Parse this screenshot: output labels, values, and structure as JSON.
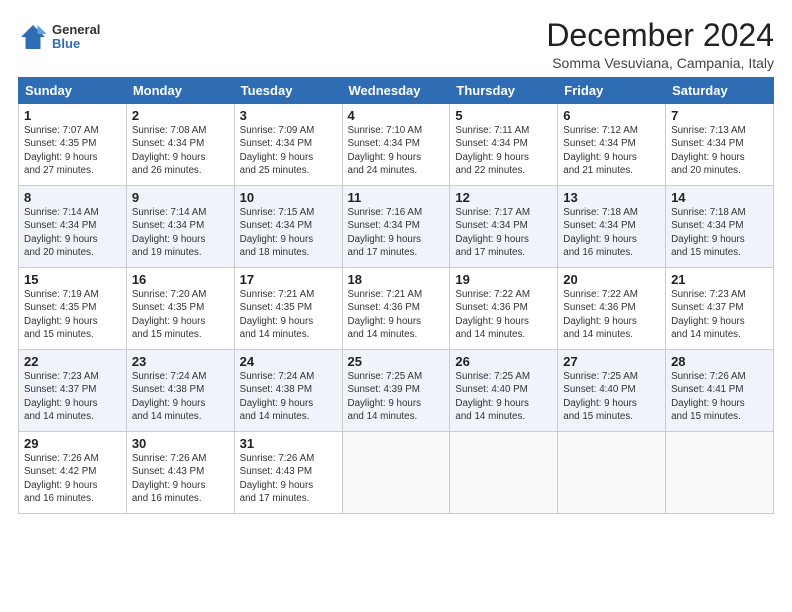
{
  "header": {
    "logo": {
      "general": "General",
      "blue": "Blue"
    },
    "title": "December 2024",
    "subtitle": "Somma Vesuviana, Campania, Italy"
  },
  "calendar": {
    "days_of_week": [
      "Sunday",
      "Monday",
      "Tuesday",
      "Wednesday",
      "Thursday",
      "Friday",
      "Saturday"
    ],
    "weeks": [
      [
        {
          "day": "1",
          "info": "Sunrise: 7:07 AM\nSunset: 4:35 PM\nDaylight: 9 hours\nand 27 minutes."
        },
        {
          "day": "2",
          "info": "Sunrise: 7:08 AM\nSunset: 4:34 PM\nDaylight: 9 hours\nand 26 minutes."
        },
        {
          "day": "3",
          "info": "Sunrise: 7:09 AM\nSunset: 4:34 PM\nDaylight: 9 hours\nand 25 minutes."
        },
        {
          "day": "4",
          "info": "Sunrise: 7:10 AM\nSunset: 4:34 PM\nDaylight: 9 hours\nand 24 minutes."
        },
        {
          "day": "5",
          "info": "Sunrise: 7:11 AM\nSunset: 4:34 PM\nDaylight: 9 hours\nand 22 minutes."
        },
        {
          "day": "6",
          "info": "Sunrise: 7:12 AM\nSunset: 4:34 PM\nDaylight: 9 hours\nand 21 minutes."
        },
        {
          "day": "7",
          "info": "Sunrise: 7:13 AM\nSunset: 4:34 PM\nDaylight: 9 hours\nand 20 minutes."
        }
      ],
      [
        {
          "day": "8",
          "info": "Sunrise: 7:14 AM\nSunset: 4:34 PM\nDaylight: 9 hours\nand 20 minutes."
        },
        {
          "day": "9",
          "info": "Sunrise: 7:14 AM\nSunset: 4:34 PM\nDaylight: 9 hours\nand 19 minutes."
        },
        {
          "day": "10",
          "info": "Sunrise: 7:15 AM\nSunset: 4:34 PM\nDaylight: 9 hours\nand 18 minutes."
        },
        {
          "day": "11",
          "info": "Sunrise: 7:16 AM\nSunset: 4:34 PM\nDaylight: 9 hours\nand 17 minutes."
        },
        {
          "day": "12",
          "info": "Sunrise: 7:17 AM\nSunset: 4:34 PM\nDaylight: 9 hours\nand 17 minutes."
        },
        {
          "day": "13",
          "info": "Sunrise: 7:18 AM\nSunset: 4:34 PM\nDaylight: 9 hours\nand 16 minutes."
        },
        {
          "day": "14",
          "info": "Sunrise: 7:18 AM\nSunset: 4:34 PM\nDaylight: 9 hours\nand 15 minutes."
        }
      ],
      [
        {
          "day": "15",
          "info": "Sunrise: 7:19 AM\nSunset: 4:35 PM\nDaylight: 9 hours\nand 15 minutes."
        },
        {
          "day": "16",
          "info": "Sunrise: 7:20 AM\nSunset: 4:35 PM\nDaylight: 9 hours\nand 15 minutes."
        },
        {
          "day": "17",
          "info": "Sunrise: 7:21 AM\nSunset: 4:35 PM\nDaylight: 9 hours\nand 14 minutes."
        },
        {
          "day": "18",
          "info": "Sunrise: 7:21 AM\nSunset: 4:36 PM\nDaylight: 9 hours\nand 14 minutes."
        },
        {
          "day": "19",
          "info": "Sunrise: 7:22 AM\nSunset: 4:36 PM\nDaylight: 9 hours\nand 14 minutes."
        },
        {
          "day": "20",
          "info": "Sunrise: 7:22 AM\nSunset: 4:36 PM\nDaylight: 9 hours\nand 14 minutes."
        },
        {
          "day": "21",
          "info": "Sunrise: 7:23 AM\nSunset: 4:37 PM\nDaylight: 9 hours\nand 14 minutes."
        }
      ],
      [
        {
          "day": "22",
          "info": "Sunrise: 7:23 AM\nSunset: 4:37 PM\nDaylight: 9 hours\nand 14 minutes."
        },
        {
          "day": "23",
          "info": "Sunrise: 7:24 AM\nSunset: 4:38 PM\nDaylight: 9 hours\nand 14 minutes."
        },
        {
          "day": "24",
          "info": "Sunrise: 7:24 AM\nSunset: 4:38 PM\nDaylight: 9 hours\nand 14 minutes."
        },
        {
          "day": "25",
          "info": "Sunrise: 7:25 AM\nSunset: 4:39 PM\nDaylight: 9 hours\nand 14 minutes."
        },
        {
          "day": "26",
          "info": "Sunrise: 7:25 AM\nSunset: 4:40 PM\nDaylight: 9 hours\nand 14 minutes."
        },
        {
          "day": "27",
          "info": "Sunrise: 7:25 AM\nSunset: 4:40 PM\nDaylight: 9 hours\nand 15 minutes."
        },
        {
          "day": "28",
          "info": "Sunrise: 7:26 AM\nSunset: 4:41 PM\nDaylight: 9 hours\nand 15 minutes."
        }
      ],
      [
        {
          "day": "29",
          "info": "Sunrise: 7:26 AM\nSunset: 4:42 PM\nDaylight: 9 hours\nand 16 minutes."
        },
        {
          "day": "30",
          "info": "Sunrise: 7:26 AM\nSunset: 4:43 PM\nDaylight: 9 hours\nand 16 minutes."
        },
        {
          "day": "31",
          "info": "Sunrise: 7:26 AM\nSunset: 4:43 PM\nDaylight: 9 hours\nand 17 minutes."
        },
        {
          "day": "",
          "info": ""
        },
        {
          "day": "",
          "info": ""
        },
        {
          "day": "",
          "info": ""
        },
        {
          "day": "",
          "info": ""
        }
      ]
    ]
  }
}
